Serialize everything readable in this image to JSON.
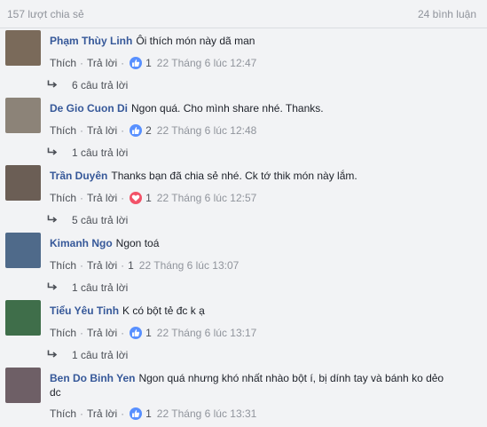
{
  "header": {
    "shares": "157 lượt chia sẻ",
    "comments_count": "24 bình luận"
  },
  "labels": {
    "like": "Thích",
    "reply": "Trả lời",
    "dot": "·"
  },
  "comments": [
    {
      "author": "Phạm Thùy Linh",
      "text": "Ôi thích món này dã man",
      "reaction": "like",
      "reaction_count": "1",
      "time": "22 Tháng 6 lúc 12:47",
      "replies": "6 câu trả lời",
      "avatar_color": "#7a6a5a"
    },
    {
      "author": "De Gio Cuon Di",
      "text": "Ngon quá. Cho mình share nhé. Thanks.",
      "reaction": "like",
      "reaction_count": "2",
      "time": "22 Tháng 6 lúc 12:48",
      "replies": "1 câu trả lời",
      "avatar_color": "#8c8378"
    },
    {
      "author": "Trần Duyên",
      "text": "Thanks bạn đã chia sẻ nhé. Ck tớ thik món này lắm.",
      "reaction": "heart",
      "reaction_count": "1",
      "time": "22 Tháng 6 lúc 12:57",
      "replies": "5 câu trả lời",
      "avatar_color": "#6b5e55"
    },
    {
      "author": "Kimanh Ngo",
      "text": "Ngon toá",
      "reaction": "none",
      "reaction_count": "1",
      "time": "22 Tháng 6 lúc 13:07",
      "replies": "1 câu trả lời",
      "avatar_color": "#4f6a8a"
    },
    {
      "author": "Tiểu Yêu Tinh",
      "text": "K có bột tẻ đc k ạ",
      "reaction": "like",
      "reaction_count": "1",
      "time": "22 Tháng 6 lúc 13:17",
      "replies": "1 câu trả lời",
      "avatar_color": "#3f6e4a"
    },
    {
      "author": "Ben Do Binh Yen",
      "text": "Ngon quá nhưng khó nhất nhào bột í, bị dính tay và bánh ko dẻo dc",
      "reaction": "like",
      "reaction_count": "1",
      "time": "22 Tháng 6 lúc 13:31",
      "replies": "",
      "avatar_color": "#6e5f66"
    }
  ]
}
